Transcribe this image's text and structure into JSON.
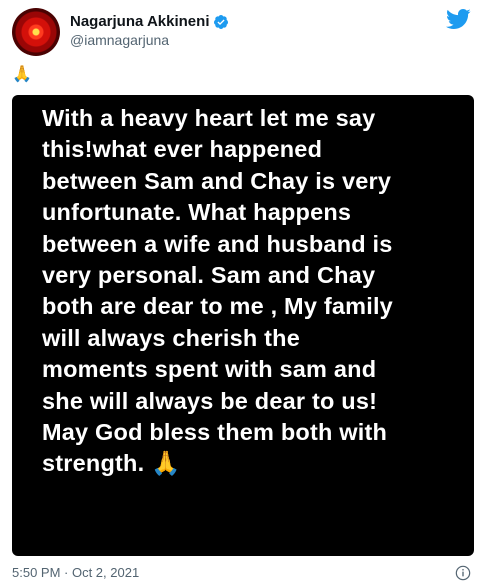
{
  "author": {
    "display_name": "Nagarjuna Akkineni",
    "handle": "@iamnagarjuna",
    "verified": true,
    "avatar_icon": "red-sun-avatar"
  },
  "tweet": {
    "emoji_line": "🙏",
    "image_text": "With a heavy heart let me say\nthis!what ever happened\nbetween Sam and Chay is very\nunfortunate. What happens\nbetween a wife and husband is\nvery personal. Sam and Chay\nboth are  dear to me , My family\nwill always cherish the\nmoments spent with sam and\nshe will always be dear to us!\nMay God bless them both with\nstrength. 🙏",
    "timestamp": "5:50 PM · Oct 2, 2021"
  },
  "icons": {
    "brand": "twitter-bird-icon",
    "verified": "verified-badge-icon",
    "info": "info-icon"
  },
  "colors": {
    "brand": "#1d9bf0",
    "text": "#0f1419",
    "muted": "#536471",
    "image_bg": "#000000"
  }
}
